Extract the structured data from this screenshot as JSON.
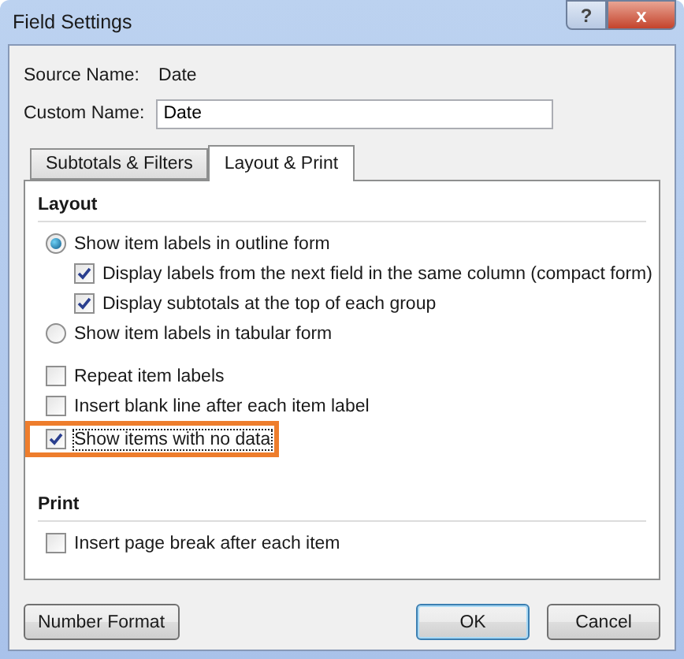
{
  "window": {
    "title": "Field Settings",
    "help_button": "?",
    "close_button": "x"
  },
  "source_name": {
    "label": "Source Name:",
    "value": "Date"
  },
  "custom_name": {
    "label": "Custom Name:",
    "value": "Date"
  },
  "tabs": [
    {
      "label": "Subtotals & Filters",
      "selected": false
    },
    {
      "label": "Layout & Print",
      "selected": true
    }
  ],
  "layout_section": {
    "heading": "Layout",
    "options": [
      {
        "kind": "radio",
        "label": "Show item labels in outline form",
        "checked": true,
        "highlighted": false,
        "children": [
          {
            "kind": "checkbox",
            "label": "Display labels from the next field in the same column (compact form)",
            "checked": true,
            "highlighted": false
          },
          {
            "kind": "checkbox",
            "label": "Display subtotals at the top of each group",
            "checked": true,
            "highlighted": false
          }
        ]
      },
      {
        "kind": "radio",
        "label": "Show item labels in tabular form",
        "checked": false,
        "highlighted": false
      },
      {
        "kind": "gap"
      },
      {
        "kind": "checkbox",
        "label": "Repeat item labels",
        "checked": false,
        "highlighted": false
      },
      {
        "kind": "checkbox",
        "label": "Insert blank line after each item label",
        "checked": false,
        "highlighted": false
      },
      {
        "kind": "checkbox",
        "label": "Show items with no data",
        "checked": true,
        "highlighted": true
      }
    ]
  },
  "print_section": {
    "heading": "Print",
    "options": [
      {
        "kind": "checkbox",
        "label": "Insert page break after each item",
        "checked": false,
        "highlighted": false
      }
    ]
  },
  "buttons": [
    {
      "label": "Number Format",
      "default": false
    },
    {
      "label": "OK",
      "default": true
    },
    {
      "label": "Cancel",
      "default": false
    }
  ]
}
